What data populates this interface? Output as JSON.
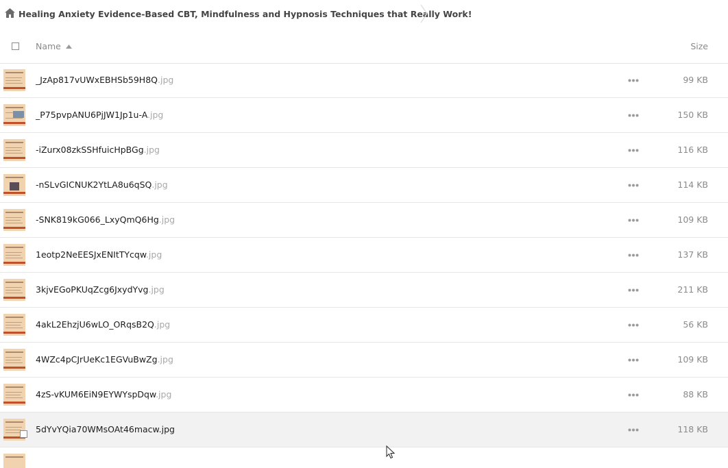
{
  "breadcrumb": {
    "title": "Healing Anxiety Evidence-Based CBT, Mindfulness and Hypnosis Techniques that Really Work!"
  },
  "header": {
    "name_label": "Name",
    "size_label": "Size"
  },
  "files": [
    {
      "name": "_JzAp817vUWxEBHSb59H8Q",
      "ext": ".jpg",
      "size": "99 KB"
    },
    {
      "name": "_P75pvpANU6PjJW1Jp1u-A",
      "ext": ".jpg",
      "size": "150 KB"
    },
    {
      "name": "-iZurx08zkSSHfuicHpBGg",
      "ext": ".jpg",
      "size": "116 KB"
    },
    {
      "name": "-nSLvGICNUK2YtLA8u6qSQ",
      "ext": ".jpg",
      "size": "114 KB"
    },
    {
      "name": "-SNK819kG066_LxyQmQ6Hg",
      "ext": ".jpg",
      "size": "109 KB"
    },
    {
      "name": "1eotp2NeEESJxENItTYcqw",
      "ext": ".jpg",
      "size": "137 KB"
    },
    {
      "name": "3kjvEGoPKUqZcg6JxydYvg",
      "ext": ".jpg",
      "size": "211 KB"
    },
    {
      "name": "4akL2EhzjU6wLO_ORqsB2Q",
      "ext": ".jpg",
      "size": "56 KB"
    },
    {
      "name": "4WZc4pCJrUeKc1EGVuBwZg",
      "ext": ".jpg",
      "size": "109 KB"
    },
    {
      "name": "4zS-vKUM6EiN9EYWYspDqw",
      "ext": ".jpg",
      "size": "88 KB"
    },
    {
      "name": "5dYvYQia70WMsOAt46macw",
      "ext": ".jpg",
      "size": "118 KB"
    }
  ],
  "colors": {
    "accent_bar": "#c0502a",
    "thumb_bg": "#f2d3b0",
    "hover_row": "#f2f2f2"
  }
}
